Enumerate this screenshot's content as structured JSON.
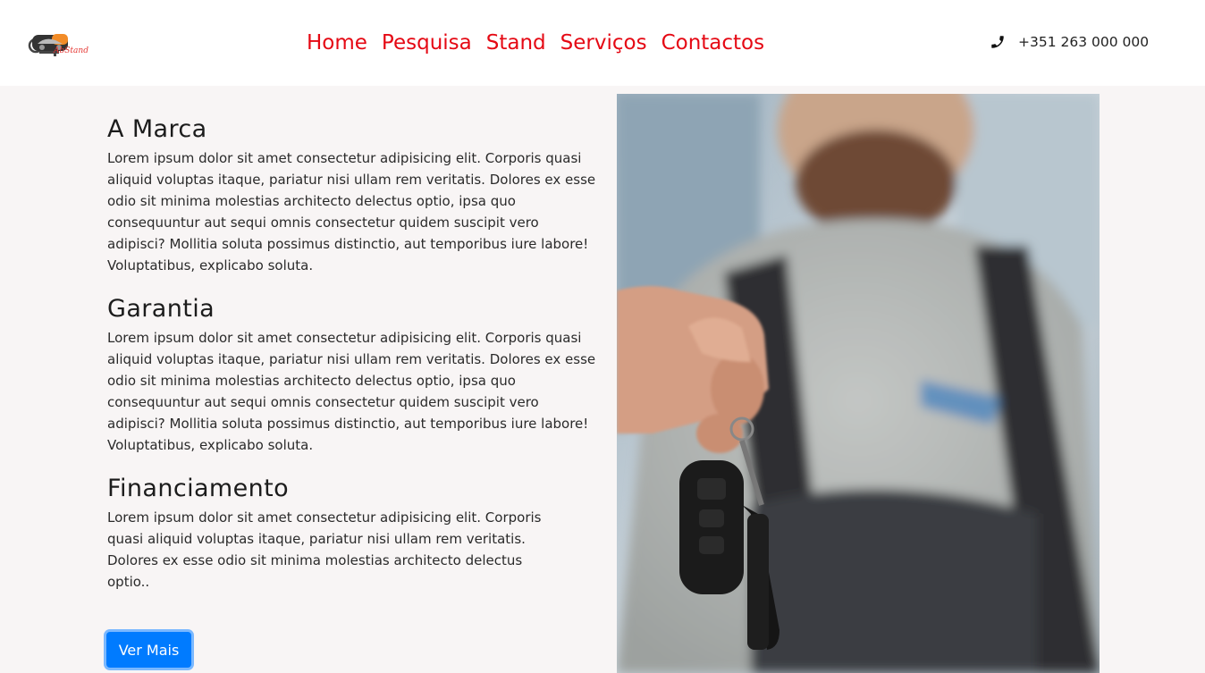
{
  "brand": {
    "logo_text": "AbStand"
  },
  "nav": {
    "items": [
      {
        "label": "Home"
      },
      {
        "label": "Pesquisa"
      },
      {
        "label": "Stand"
      },
      {
        "label": "Serviços"
      },
      {
        "label": "Contactos"
      }
    ],
    "link_color": "#e50914"
  },
  "contact": {
    "phone": "+351 263 000 000",
    "icon": "phone-icon"
  },
  "sections": [
    {
      "title": "A Marca",
      "body": "Lorem ipsum dolor sit amet consectetur adipisicing elit. Corporis quasi aliquid voluptas itaque, pariatur nisi ullam rem veritatis. Dolores ex esse odio sit minima molestias architecto delectus optio, ipsa quo consequuntur aut sequi omnis consectetur quidem suscipit vero adipisci? Mollitia soluta possimus distinctio, aut temporibus iure labore! Voluptatibus, explicabo soluta."
    },
    {
      "title": "Garantia",
      "body": "Lorem ipsum dolor sit amet consectetur adipisicing elit. Corporis quasi aliquid voluptas itaque, pariatur nisi ullam rem veritatis. Dolores ex esse odio sit minima molestias architecto delectus optio, ipsa quo consequuntur aut sequi omnis consectetur quidem suscipit vero adipisci? Mollitia soluta possimus distinctio, aut temporibus iure labore! Voluptatibus, explicabo soluta."
    },
    {
      "title": "Financiamento",
      "body": "Lorem ipsum dolor sit amet consectetur adipisicing elit. Corporis quasi aliquid voluptas itaque, pariatur nisi ullam rem veritatis. Dolores ex esse odio sit minima molestias architecto delectus optio.."
    }
  ],
  "cta": {
    "label": "Ver Mais",
    "color": "#007bff"
  }
}
